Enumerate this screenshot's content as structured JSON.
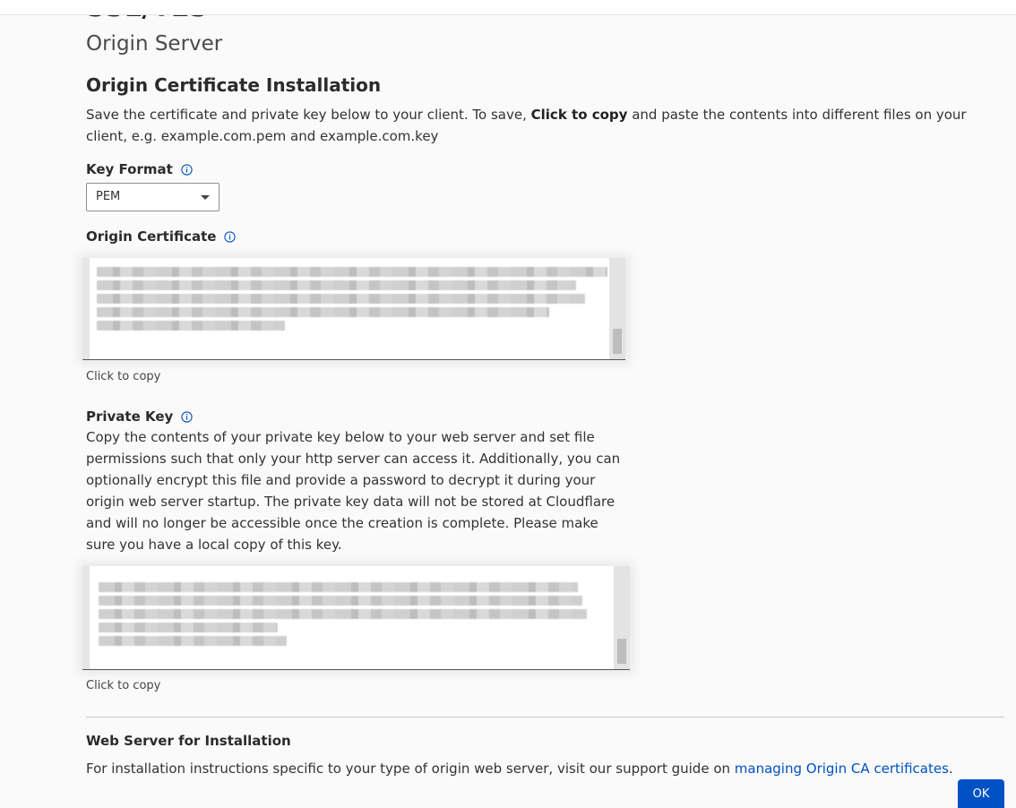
{
  "page": {
    "title": "SSL/TLS",
    "subtitle": "Origin Server"
  },
  "section": {
    "title": "Origin Certificate Installation",
    "intro_before": "Save the certificate and private key below to your client. To save, ",
    "intro_bold": "Click to copy",
    "intro_after": " and paste the contents into different files on your client, e.g. example.com.pem and example.com.key"
  },
  "key_format": {
    "label": "Key Format",
    "selected": "PEM"
  },
  "origin_certificate": {
    "label": "Origin Certificate",
    "copy_caption": "Click to copy"
  },
  "private_key": {
    "label": "Private Key",
    "description": "Copy the contents of your private key below to your web server and set file permissions such that only your http server can access it. Additionally, you can optionally encrypt this file and provide a password to decrypt it during your origin web server startup. The private key data will not be stored at Cloudflare and will no longer be accessible once the creation is complete. Please make sure you have a local copy of this key.",
    "copy_caption": "Click to copy"
  },
  "web_server": {
    "title": "Web Server for Installation",
    "text_before": "For installation instructions specific to your type of origin web server, visit our support guide on ",
    "link_text": "managing Origin CA certificates",
    "text_after": "."
  },
  "footer": {
    "ok_label": "OK"
  },
  "colors": {
    "link": "#0051c3",
    "primary_button": "#0051c3"
  },
  "icons": {
    "info": "info-circle-icon",
    "dropdown": "caret-down-icon"
  }
}
